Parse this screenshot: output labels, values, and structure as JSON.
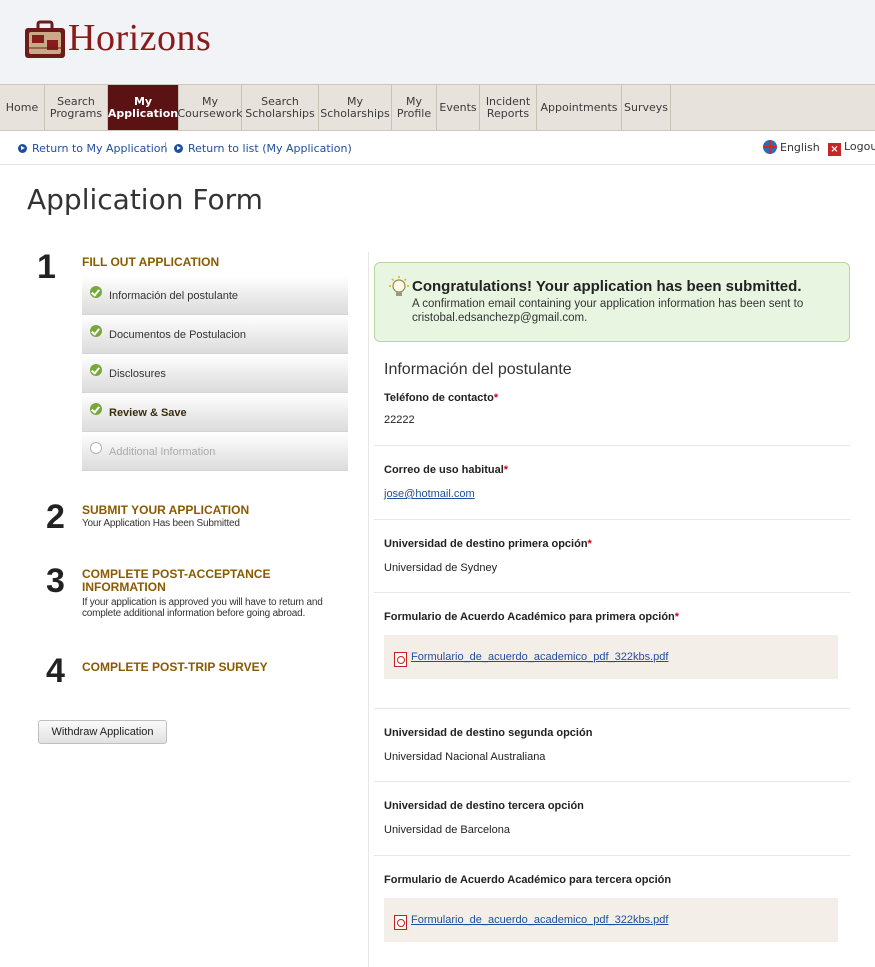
{
  "header": {
    "brand": "Horizons"
  },
  "nav": [
    {
      "label": "Home",
      "active": false
    },
    {
      "label": "Search\nPrograms",
      "active": false
    },
    {
      "label": "My\nApplication",
      "active": true
    },
    {
      "label": "My\nCoursework",
      "active": false
    },
    {
      "label": "Search\nScholarships",
      "active": false
    },
    {
      "label": "My\nScholarships",
      "active": false
    },
    {
      "label": "My\nProfile",
      "active": false
    },
    {
      "label": "Events",
      "active": false
    },
    {
      "label": "Incident\nReports",
      "active": false
    },
    {
      "label": "Appointments",
      "active": false
    },
    {
      "label": "Surveys",
      "active": false
    }
  ],
  "subbar": {
    "return_app": "Return to My Application",
    "separator": "|",
    "return_list": "Return to list (My Application)",
    "language": "English",
    "logout": "Logou"
  },
  "page": {
    "title": "Application Form"
  },
  "steps": [
    {
      "number": "1",
      "title": "FILL OUT APPLICATION",
      "desc": ""
    },
    {
      "number": "2",
      "title": "SUBMIT YOUR APPLICATION",
      "desc": "Your Application Has been Submitted"
    },
    {
      "number": "3",
      "title": "COMPLETE POST-ACCEPTANCE INFORMATION",
      "desc": "If your application is approved you will have to return and complete additional information before going abroad."
    },
    {
      "number": "4",
      "title": "COMPLETE POST-TRIP SURVEY",
      "desc": ""
    }
  ],
  "substeps": [
    {
      "label": "Información del postulante",
      "status": "done"
    },
    {
      "label": "Documentos de Postulacion",
      "status": "done"
    },
    {
      "label": "Disclosures",
      "status": "done"
    },
    {
      "label": "Review & Save",
      "status": "current"
    },
    {
      "label": "Additional Information",
      "status": "pending"
    }
  ],
  "withdraw_label": "Withdraw Application",
  "success": {
    "title": "Congratulations! Your application has been submitted.",
    "body": "A confirmation email containing your application information has been sent to cristobal.edsanchezp@gmail.com."
  },
  "section": {
    "title": "Información del postulante"
  },
  "fields": [
    {
      "label": "Teléfono de contacto",
      "required": "*",
      "value": "22222"
    },
    {
      "label": "Correo de uso habitual",
      "required": "*",
      "value": "jose@hotmail.com"
    },
    {
      "label": "Universidad de destino primera opción",
      "required": "*",
      "value": "Universidad de Sydney"
    },
    {
      "label": "Formulario de Acuerdo Académico para primera opción",
      "required": "*",
      "file": "Formulario_de_acuerdo_academico_pdf_322kbs.pdf"
    },
    {
      "label": "Universidad de destino segunda opción",
      "value": "Universidad Nacional Australiana"
    },
    {
      "label": "Universidad de destino tercera opción",
      "value": "Universidad de Barcelona"
    },
    {
      "label": "Formulario de Acuerdo Académico para tercera opción",
      "file": "Formulario_de_acuerdo_academico_pdf_322kbs.pdf"
    }
  ],
  "colors": {
    "brand": "#8a1b1b",
    "nav_active": "#5a1212",
    "step_title": "#8a5a00",
    "link": "#1f4e9e",
    "success_bg": "#e8f5e1"
  }
}
